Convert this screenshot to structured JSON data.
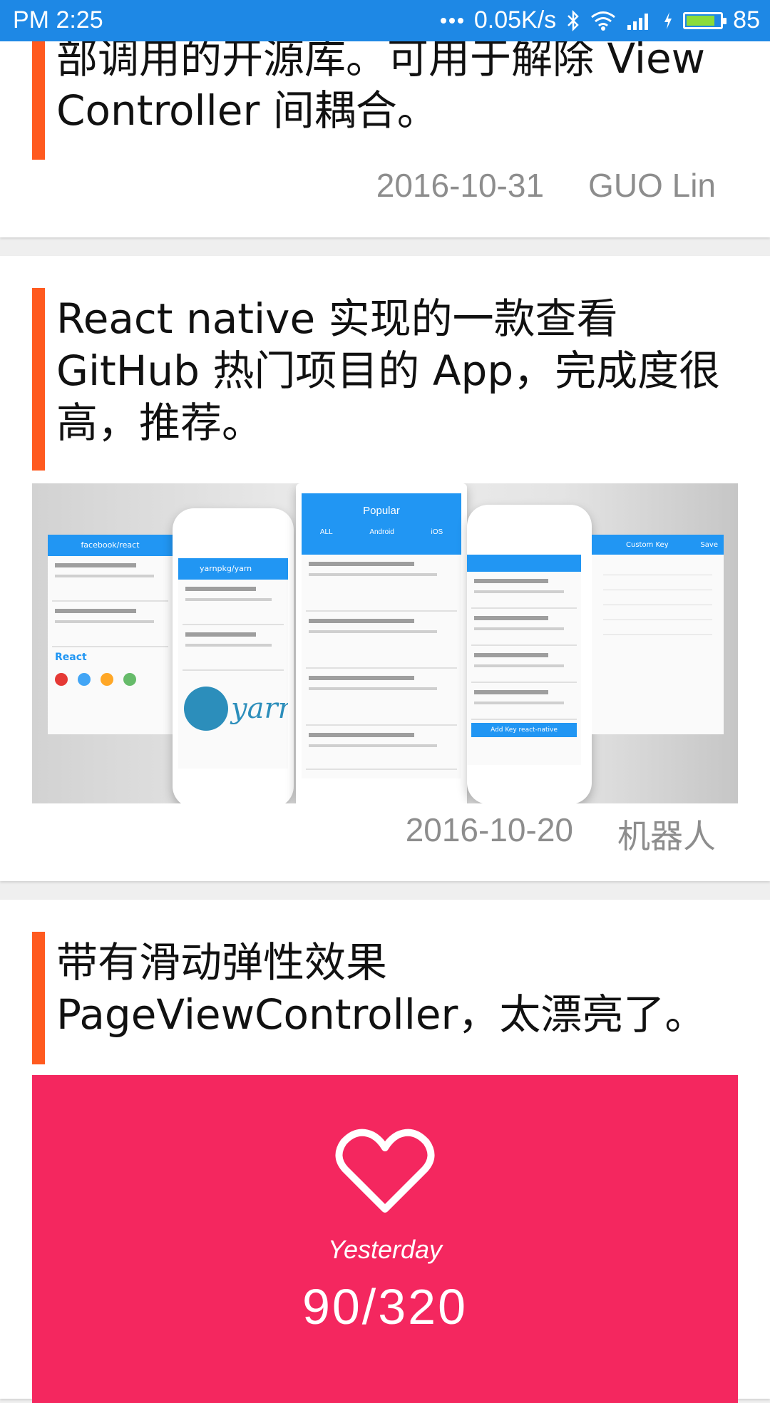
{
  "status_bar": {
    "left": "PM  2:25",
    "network_speed": "0.05K/s",
    "battery_level": "85",
    "icons": [
      "more-dots-icon",
      "bluetooth-icon",
      "wifi-icon",
      "signal-icon",
      "charging-icon",
      "battery-icon"
    ]
  },
  "feed": [
    {
      "title": "部调用的开源库。可用于解除 View\nController 间耦合。",
      "date": "2016-10-31",
      "author": "GUO Lin"
    },
    {
      "title": "React native 实现的一款查看\nGitHub 热门项目的 App，完成度很\n高，推荐。",
      "date": "2016-10-20",
      "author": "机器人",
      "image": {
        "center_screen_title": "Popular",
        "center_tabs": [
          "ALL",
          "Android",
          "iOS"
        ],
        "center_button": "Add Key react-native",
        "left_screen_title": "facebook/react",
        "left_logo_text": "React",
        "yarn_screen_title": "yarnpkg/yarn",
        "yarn_logo_text": "yarn",
        "right_screen_title": "Custom Key",
        "right_screen_action": "Save"
      }
    },
    {
      "title": "带有滑动弹性效果\nPageViewController，太漂亮了。",
      "image": {
        "bg_color": "#f4275f",
        "label": "Yesterday",
        "count": "90/320"
      }
    }
  ],
  "colors": {
    "accent": "#ff5a1f",
    "status_bar": "#1e88e5",
    "meta_text": "#8d8d8d"
  }
}
